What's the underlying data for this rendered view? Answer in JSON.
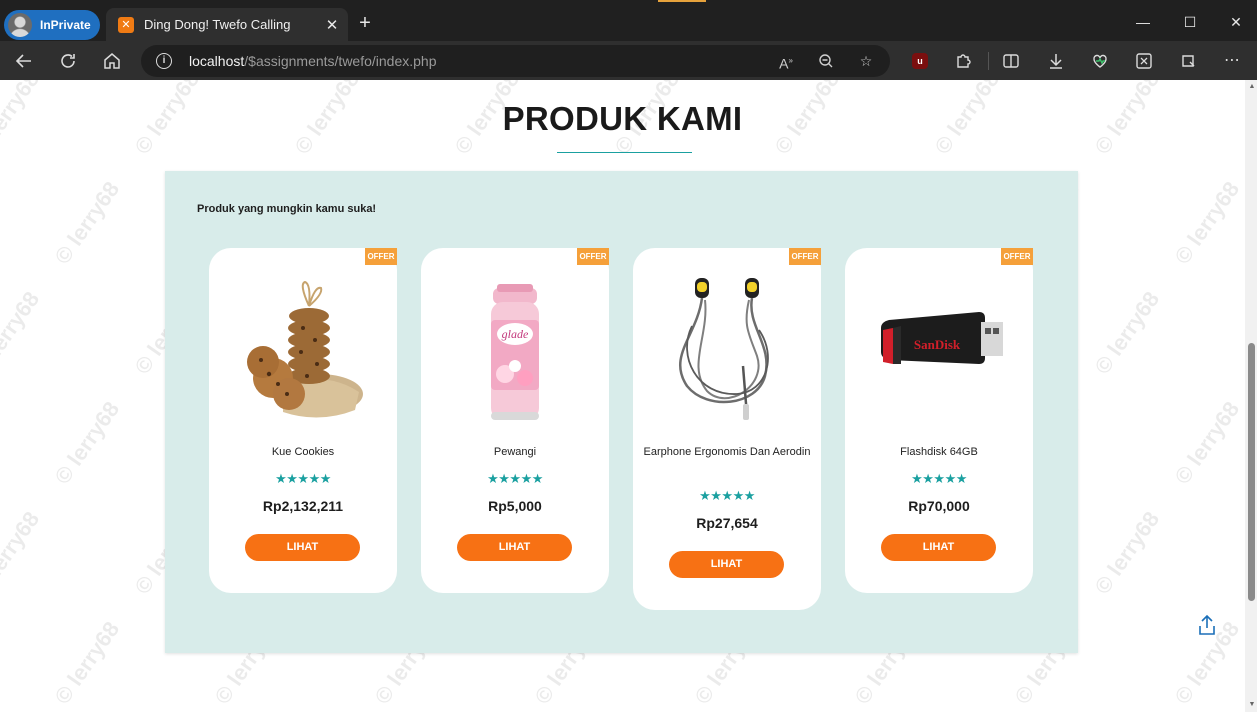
{
  "browser": {
    "profile_label": "InPrivate",
    "tab_title": "Ding Dong! Twefo Calling",
    "tab_close": "✕",
    "new_tab": "+",
    "url_host": "localhost",
    "url_path": "/$assignments/twefo/index.php",
    "window_minimize": "—",
    "window_maximize": "☐",
    "window_close": "✕"
  },
  "page": {
    "heading": "PRODUK KAMI",
    "subtitle": "Produk yang mungkin kamu suka!",
    "offer_label": "OFFER",
    "button_label": "LIHAT",
    "stars": "★★★★★",
    "watermark": "© lerry68"
  },
  "products": [
    {
      "name": "Kue Cookies",
      "price": "Rp2,132,211",
      "rating": 5
    },
    {
      "name": "Pewangi",
      "price": "Rp5,000",
      "rating": 5
    },
    {
      "name": "Earphone Ergonomis Dan Aerodin",
      "price": "Rp27,654",
      "rating": 5
    },
    {
      "name": "Flashdisk 64GB",
      "price": "Rp70,000",
      "rating": 5
    }
  ],
  "colors": {
    "accent_teal": "#1aa0a0",
    "button_orange": "#f77114",
    "offer_orange": "#f5a03a",
    "panel_bg": "#d8ecea"
  }
}
